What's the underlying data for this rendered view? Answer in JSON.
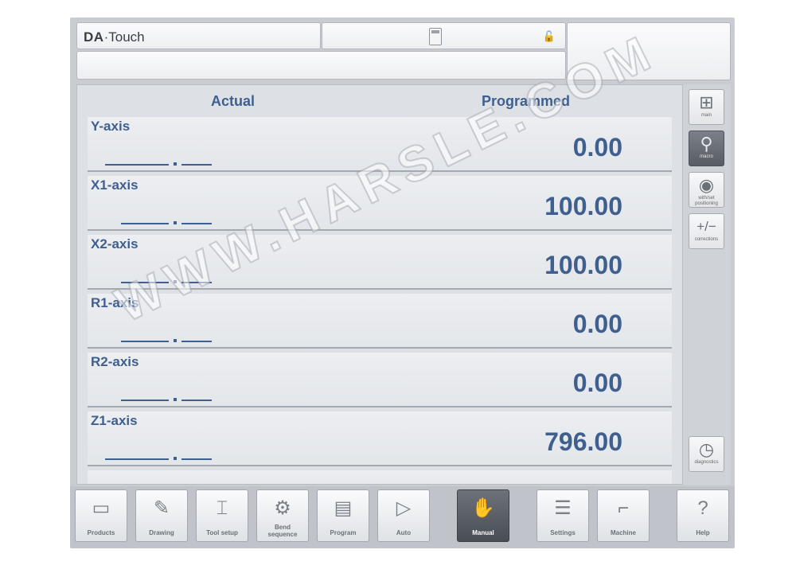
{
  "app": {
    "brand_bold": "DA",
    "brand_sep": "·",
    "brand_rest": "Touch"
  },
  "columns": {
    "actual": "Actual",
    "programmed": "Programmed"
  },
  "axes": [
    {
      "name": "Y-axis",
      "programmed": "0.00"
    },
    {
      "name": "X1-axis",
      "programmed": "100.00"
    },
    {
      "name": "X2-axis",
      "programmed": "100.00"
    },
    {
      "name": "R1-axis",
      "programmed": "0.00"
    },
    {
      "name": "R2-axis",
      "programmed": "0.00"
    },
    {
      "name": "Z1-axis",
      "programmed": "796.00"
    }
  ],
  "side_buttons": [
    {
      "icon": "main-layout-icon",
      "label": "main",
      "glyph": "⊞",
      "active": false
    },
    {
      "icon": "magnifier-icon",
      "label": "macro",
      "glyph": "⚲",
      "active": true
    },
    {
      "icon": "piggy-bank-icon",
      "label": "with/set positioning",
      "glyph": "◉",
      "active": false
    },
    {
      "icon": "plus-minus-icon",
      "label": "corrections",
      "glyph": "+/−",
      "active": false
    },
    {
      "icon": "clock-icon",
      "label": "diagnostics",
      "glyph": "◷",
      "active": false
    }
  ],
  "toolbar": [
    {
      "icon": "folder-icon",
      "label": "Products",
      "glyph": "▭",
      "active": false
    },
    {
      "icon": "drawing-icon",
      "label": "Drawing",
      "glyph": "✎",
      "active": false
    },
    {
      "icon": "tool-setup-icon",
      "label": "Tool setup",
      "glyph": "⌶",
      "active": false
    },
    {
      "icon": "bend-sequence-icon",
      "label": "Bend sequence",
      "glyph": "⚙",
      "active": false
    },
    {
      "icon": "program-icon",
      "label": "Program",
      "glyph": "▤",
      "active": false
    },
    {
      "icon": "play-icon",
      "label": "Auto",
      "glyph": "▷",
      "active": false
    },
    {
      "icon": "hand-icon",
      "label": "Manual",
      "glyph": "✋",
      "active": true
    },
    {
      "icon": "settings-icon",
      "label": "Settings",
      "glyph": "☰",
      "active": false
    },
    {
      "icon": "machine-icon",
      "label": "Machine",
      "glyph": "⌐",
      "active": false
    },
    {
      "icon": "help-icon",
      "label": "Help",
      "glyph": "?",
      "active": false
    }
  ],
  "watermark": "WWW.HARSLE.COM"
}
